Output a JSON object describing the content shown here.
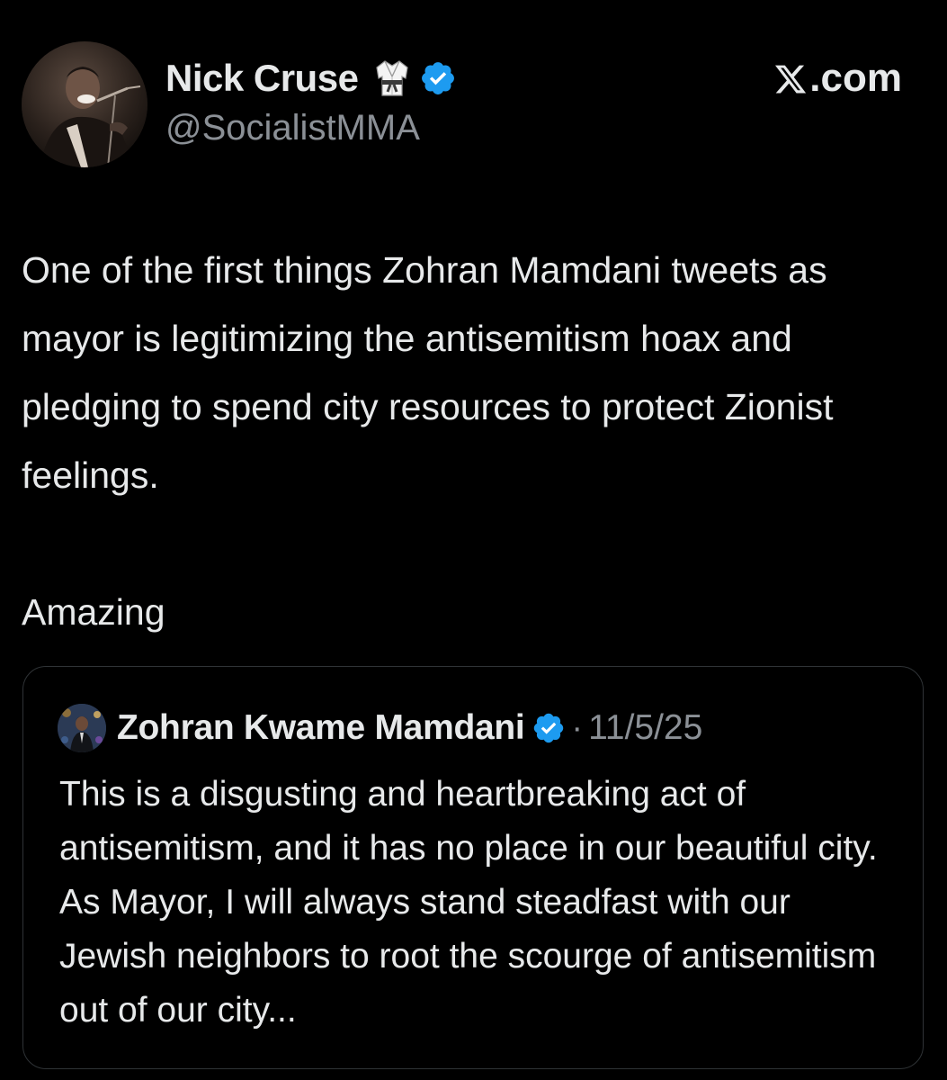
{
  "author": {
    "display_name": "Nick Cruse",
    "handle": "@SocialistMMA",
    "badge_icon": "martial-arts-gi-icon",
    "verified_icon": "verified-badge-icon"
  },
  "brand": {
    "label": ".com",
    "logo_icon": "x-logo-icon"
  },
  "post": {
    "text": "One of the first things Zohran Mamdani tweets as mayor is legitimizing the antisemitism hoax and pledging to spend city resources to protect Zionist feelings.",
    "text2": "Amazing"
  },
  "quoted_post": {
    "author_name": "Zohran Kwame Mamdani",
    "separator": "·",
    "date": "11/5/25",
    "text": "This is a disgusting and heartbreaking act of antisemitism, and it has no place in our beautiful city. As Mayor, I will always stand steadfast with our Jewish neighbors to root the scourge of antisemitism out of our city..."
  },
  "colors": {
    "background": "#000000",
    "text_primary": "#e7e9ea",
    "text_secondary": "#8b9096",
    "verified_blue": "#1d9bf0",
    "border": "#2f3336"
  }
}
